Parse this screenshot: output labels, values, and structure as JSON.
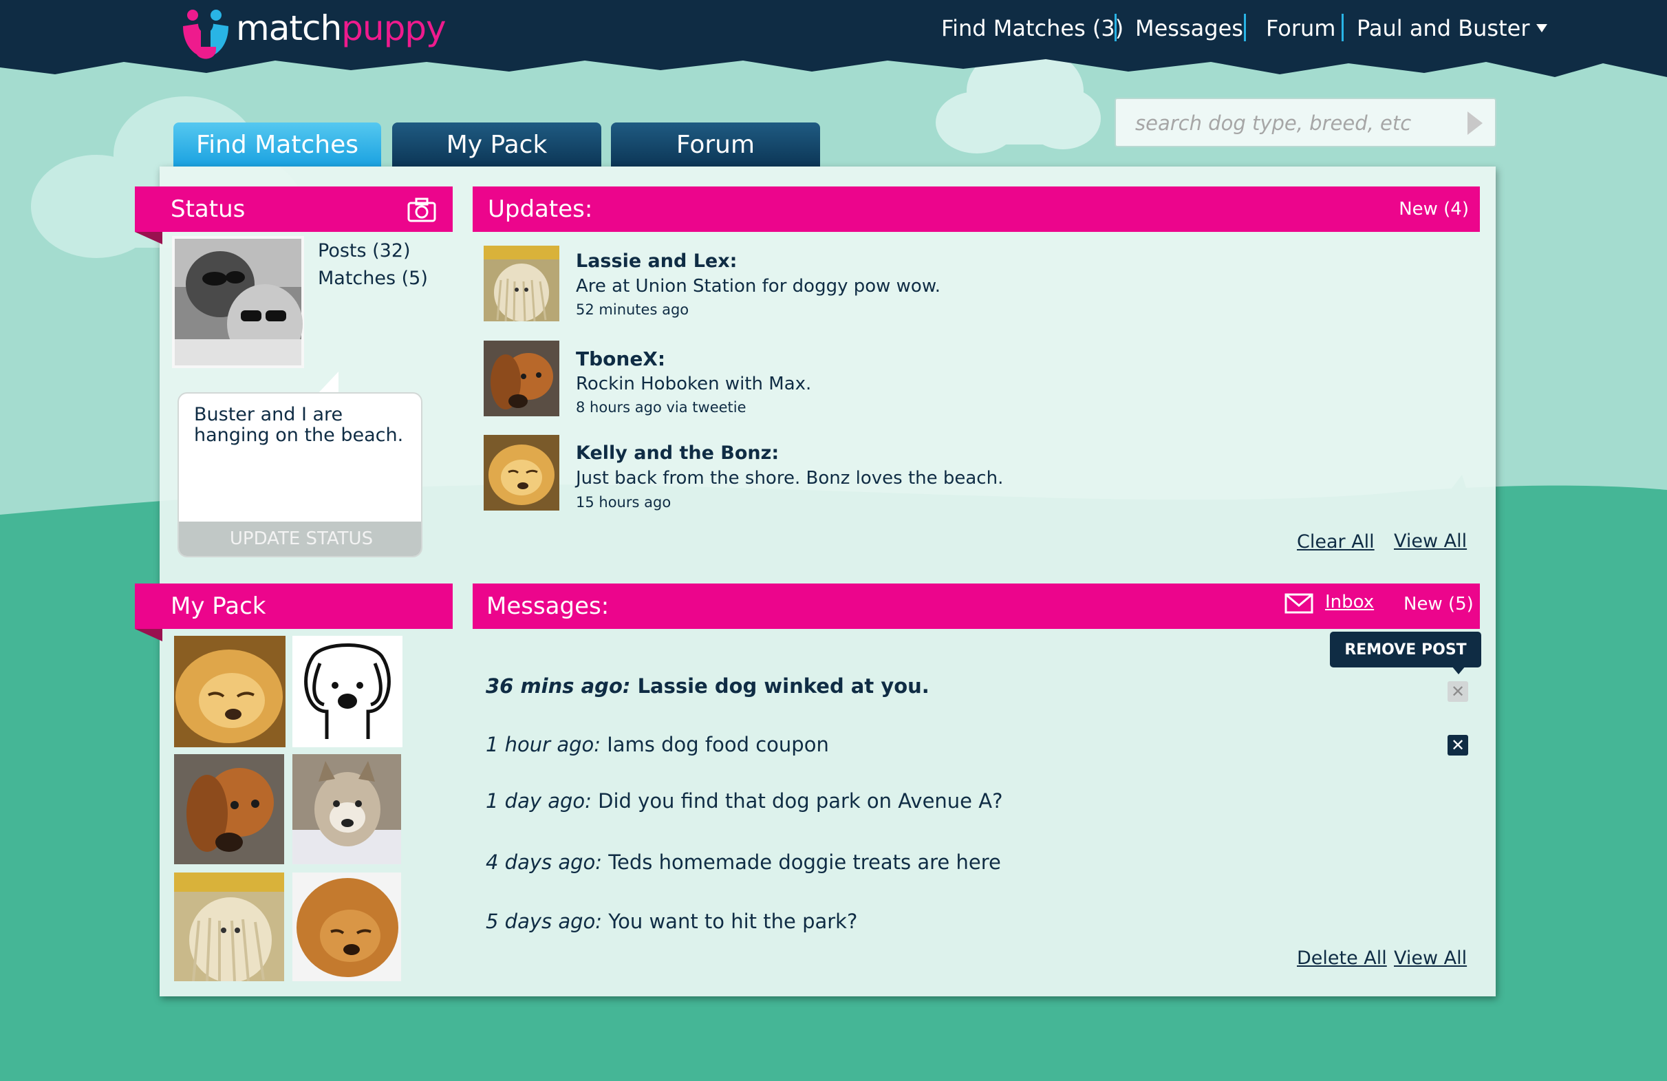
{
  "colors": {
    "navy": "#0f2c44",
    "pink": "#ec058c",
    "blue": "#29b4e5",
    "mint": "#a4dccf",
    "grass": "#45b696"
  },
  "logo": {
    "brand": "matchpuppy"
  },
  "topnav": {
    "find_matches": "Find Matches (3)",
    "messages": "Messages",
    "forum": "Forum",
    "user_menu": "Paul and Buster"
  },
  "search": {
    "placeholder": "search dog type, breed, etc"
  },
  "tabs": [
    "Find Matches",
    "My Pack",
    "Forum"
  ],
  "status": {
    "title": "Status",
    "posts": "Posts (32)",
    "matches": "Matches (5)",
    "text": "Buster and I are hanging on the beach.",
    "update_button": "UPDATE STATUS"
  },
  "updates": {
    "title": "Updates:",
    "new_count": "New (4)",
    "items": [
      {
        "name": "Lassie and Lex:",
        "text": "Are at Union Station for doggy pow wow.",
        "time": "52 minutes ago"
      },
      {
        "name": "TboneX:",
        "text": "Rockin Hoboken with Max.",
        "time": "8 hours ago via tweetie"
      },
      {
        "name": "Kelly and the Bonz:",
        "text": "Just back from the shore. Bonz loves the beach.",
        "time": "15 hours ago"
      }
    ],
    "clear_all": "Clear All",
    "view_all": "View All"
  },
  "pack": {
    "title": "My Pack"
  },
  "messages": {
    "title": "Messages:",
    "inbox": "Inbox",
    "new_count": "New (5)",
    "remove_tooltip": "REMOVE POST",
    "items": [
      {
        "time": "36 mins ago:",
        "text": "Lassie dog winked at you."
      },
      {
        "time": "1 hour ago:",
        "text": "Iams dog food coupon"
      },
      {
        "time": "1 day ago:",
        "text": "Did you find that dog park on Avenue A?"
      },
      {
        "time": "4 days ago:",
        "text": "Teds homemade doggie treats are here"
      },
      {
        "time": "5 days ago:",
        "text": "You want to hit the park?"
      }
    ],
    "delete_all": "Delete All",
    "view_all": "View All"
  }
}
